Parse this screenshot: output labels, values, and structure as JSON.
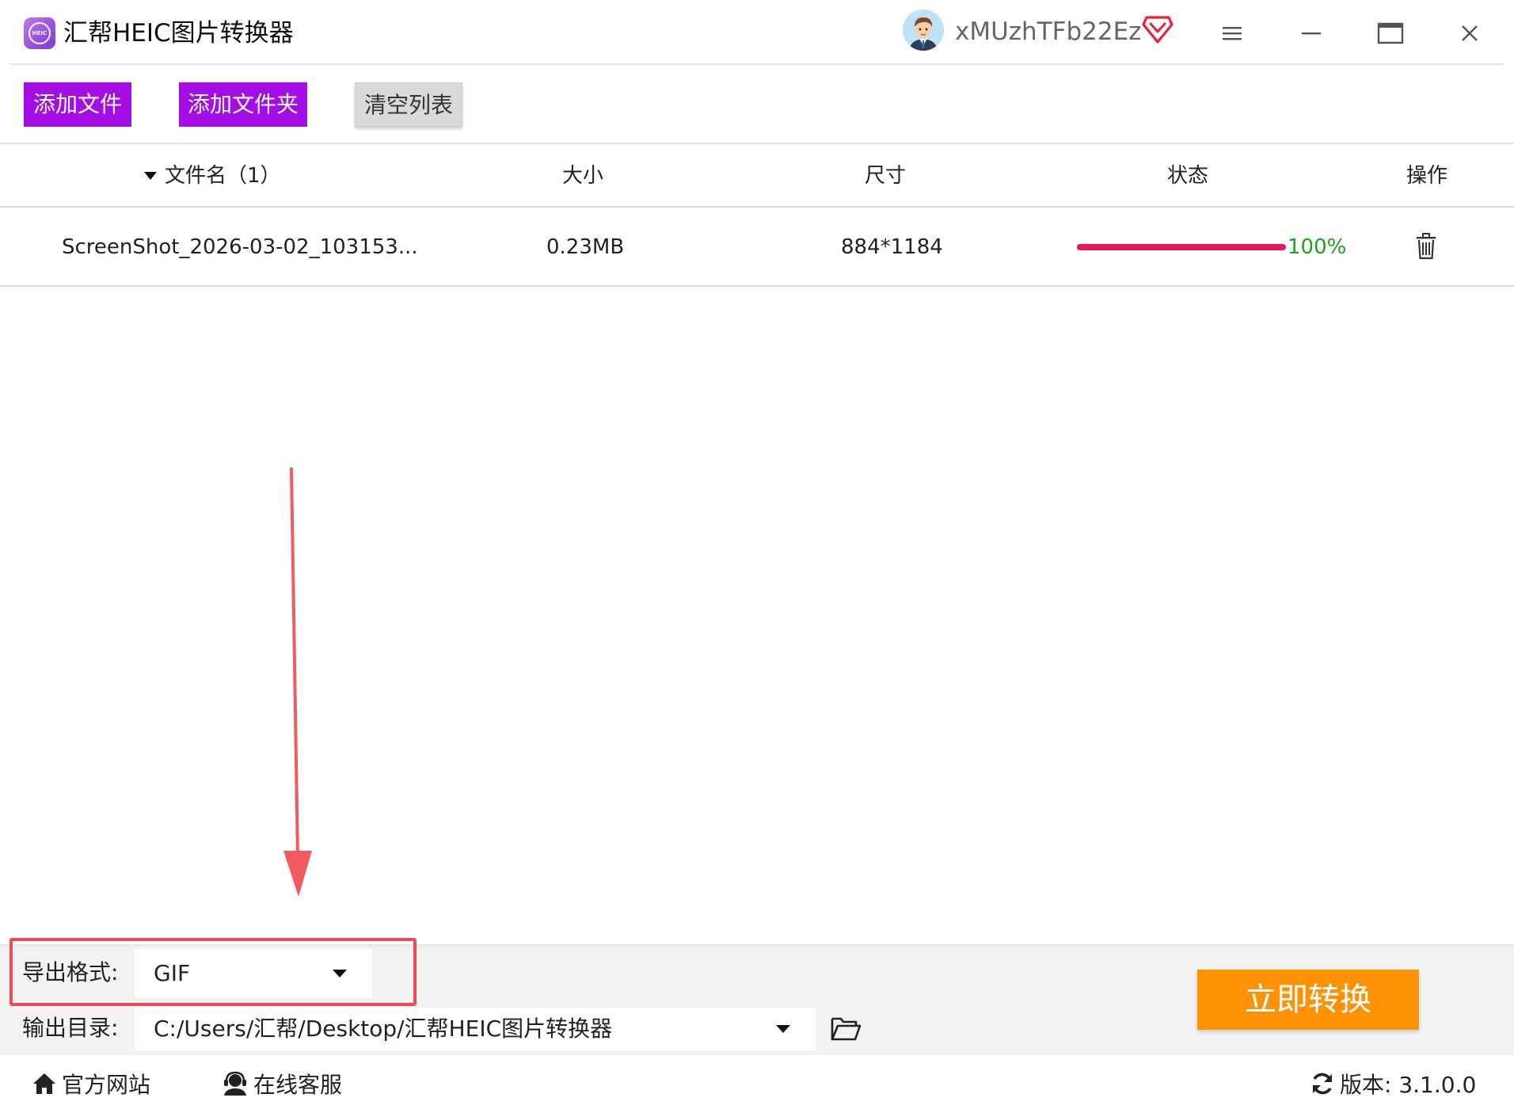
{
  "app": {
    "title": "汇帮HEIC图片转换器",
    "logo_icon": "heic-logo-icon",
    "logo_text": "HEIC"
  },
  "user": {
    "name": "xMUzhTFb22Ez",
    "avatar_icon": "user-avatar",
    "vip_icon": "vip-diamond-icon",
    "vip_color": "#e8203a"
  },
  "window_controls": [
    "menu-icon",
    "minimize-icon",
    "maximize-icon",
    "close-icon"
  ],
  "toolbar": {
    "add_file": "添加文件",
    "add_folder": "添加文件夹",
    "clear_list": "清空列表",
    "accent": "#a40ee5"
  },
  "table": {
    "headers": {
      "name": "文件名（1）",
      "size": "大小",
      "dimensions": "尺寸",
      "status": "状态",
      "action": "操作"
    },
    "rows": [
      {
        "name": "ScreenShot_2026-03-02_103153...",
        "size": "0.23MB",
        "dimensions": "884*1184",
        "progress": 1.0,
        "progress_label": "100%",
        "action_icon": "trash-icon"
      }
    ]
  },
  "export": {
    "format_label": "导出格式:",
    "format_value": "GIF",
    "outdir_label": "输出目录:",
    "outdir_value": "C:/Users/汇帮/Desktop/汇帮HEIC图片转换器",
    "folder_icon": "folder-open-icon"
  },
  "convert_button": "立即转换",
  "footer": {
    "website": "官方网站",
    "support": "在线客服",
    "version": "版本: 3.1.0.0"
  },
  "colors": {
    "progress": "#e8195b",
    "progress_text": "#1aa41a",
    "convert": "#fd9206",
    "annotation": "#ef4b55"
  }
}
